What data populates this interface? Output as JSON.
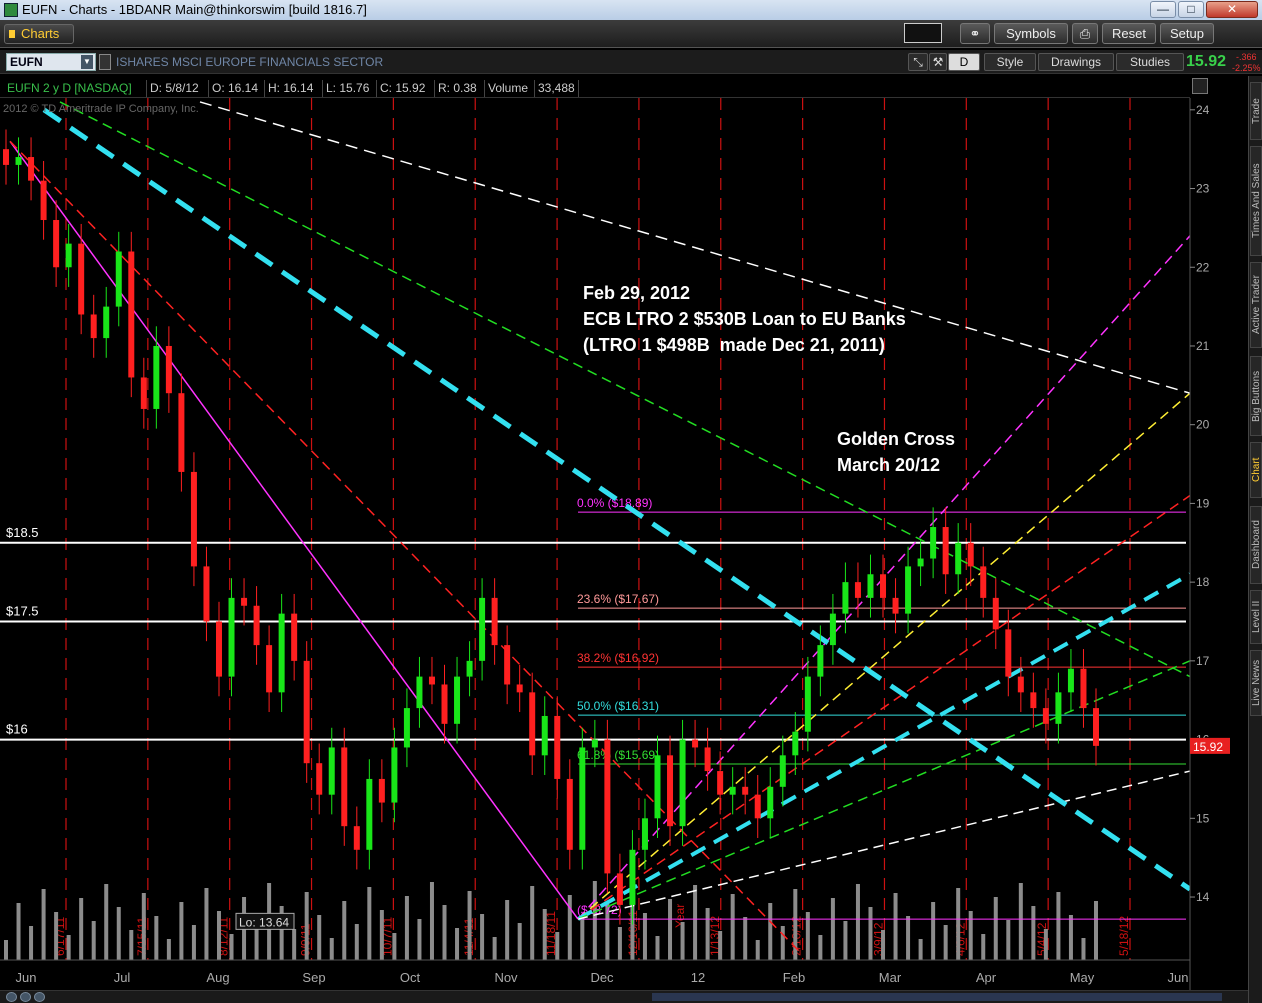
{
  "window": {
    "title": "EUFN - Charts - 1BDANR Main@thinkorswim [build 1816.7]",
    "min_label": "—",
    "max_label": "□",
    "close_label": "✕"
  },
  "toolbar": {
    "tab_label": "Charts",
    "symbols_label": "Symbols",
    "reset_label": "Reset",
    "setup_label": "Setup"
  },
  "symbol_bar": {
    "symbol": "EUFN",
    "description": "ISHARES MSCI EUROPE FINANCIALS SECTOR",
    "aggregation": "D",
    "style_label": "Style",
    "drawings_label": "Drawings",
    "studies_label": "Studies",
    "last_price": "15.92",
    "net_change": "-.366",
    "pct_change": "-2.25%"
  },
  "info_bar": {
    "title": "EUFN 2 y D [NASDAQ]",
    "date": "D: 5/8/12",
    "open": "O: 16.14",
    "high": "H: 16.14",
    "low": "L: 15.76",
    "close": "C: 15.92",
    "range": "R: 0.38",
    "volume_label": "Volume",
    "volume": "33,488"
  },
  "copyright": "2012 © TD Ameritrade IP Company, Inc.",
  "side_tabs": [
    "Trade",
    "Times And Sales",
    "Active Trader",
    "Big Buttons",
    "Chart",
    "Dashboard",
    "Level II",
    "Live News"
  ],
  "annotations": {
    "ltro_line1": "Feb 29, 2012",
    "ltro_line2": "ECB LTRO 2 $530B Loan to EU Banks",
    "ltro_line3": "(LTRO 1 $498B  made Dec 21, 2011)",
    "golden_line1": "Golden Cross",
    "golden_line2": "March 20/12"
  },
  "colors": {
    "up_candle": "#19e619",
    "down_candle": "#ff2020",
    "volume": "#8c8c8c",
    "cycle_line": "#cc1111",
    "cyan_trend": "#33e0f0",
    "magenta": "#ff33ff"
  },
  "chart_data": {
    "type": "candlestick",
    "symbol": "EUFN",
    "aggregation": "D",
    "ylim": [
      13.2,
      24.15
    ],
    "y_ticks": [
      14,
      15,
      16,
      17,
      18,
      19,
      20,
      21,
      22,
      23,
      24
    ],
    "x_ticks": [
      "Jun",
      "Jul",
      "Aug",
      "Sep",
      "Oct",
      "Nov",
      "Dec",
      "12",
      "Feb",
      "Mar",
      "Apr",
      "May",
      "Jun"
    ],
    "current_price_label": "15.92",
    "low_label": "Lo: 13.64",
    "horizontal_levels": [
      {
        "label": "$18.5",
        "value": 18.5
      },
      {
        "label": "$17.5",
        "value": 17.5
      },
      {
        "label": "$16",
        "value": 16.0
      }
    ],
    "fibonacci": [
      {
        "label": "0.0%",
        "price": "($18.89)",
        "value": 18.89,
        "color": "#ff33ff"
      },
      {
        "label": "23.6%",
        "price": "($17.67)",
        "value": 17.67,
        "color": "#ff9999"
      },
      {
        "label": "38.2%",
        "price": "($16.92)",
        "value": 16.92,
        "color": "#ff3333"
      },
      {
        "label": "50.0%",
        "price": "($16.31)",
        "value": 16.31,
        "color": "#33dddd"
      },
      {
        "label": "61.8%",
        "price": "($15.69)",
        "value": 15.69,
        "color": "#33dd33"
      },
      {
        "label": "",
        "price": "($13.72)",
        "value": 13.72,
        "color": "#ff33ff"
      }
    ],
    "cycle_dates": [
      "6/17/11",
      "7/15/11",
      "8/12/11",
      "9/9/11",
      "10/7/11",
      "11/4/11",
      "11/18/11",
      "12/16/11",
      "1/13/12",
      "2/10/12",
      "3/9/12",
      "4/6/12",
      "5/4/12",
      "5/18/12"
    ],
    "cycle_tag": "Year",
    "close_series_approx": [
      23.3,
      23.4,
      23.1,
      22.6,
      22.0,
      22.3,
      21.4,
      21.1,
      21.5,
      22.2,
      20.6,
      20.2,
      21.0,
      20.4,
      19.4,
      18.2,
      17.5,
      16.8,
      17.8,
      17.7,
      17.2,
      16.6,
      17.6,
      17.0,
      15.7,
      15.3,
      15.9,
      14.9,
      14.6,
      15.5,
      15.2,
      15.9,
      16.4,
      16.8,
      16.7,
      16.2,
      16.8,
      17.0,
      17.8,
      17.2,
      16.7,
      16.6,
      15.8,
      16.3,
      15.5,
      14.6,
      15.9,
      16.0,
      14.3,
      13.9,
      14.6,
      15.0,
      15.8,
      14.9,
      16.0,
      15.9,
      15.6,
      15.3,
      15.4,
      15.3,
      15.0,
      15.4,
      15.8,
      16.1,
      16.8,
      17.2,
      17.6,
      18.0,
      17.8,
      18.1,
      17.8,
      17.6,
      18.2,
      18.3,
      18.7,
      18.1,
      18.5,
      18.2,
      17.8,
      17.4,
      16.8,
      16.6,
      16.4,
      16.2,
      16.6,
      16.9,
      16.4,
      15.92
    ]
  }
}
